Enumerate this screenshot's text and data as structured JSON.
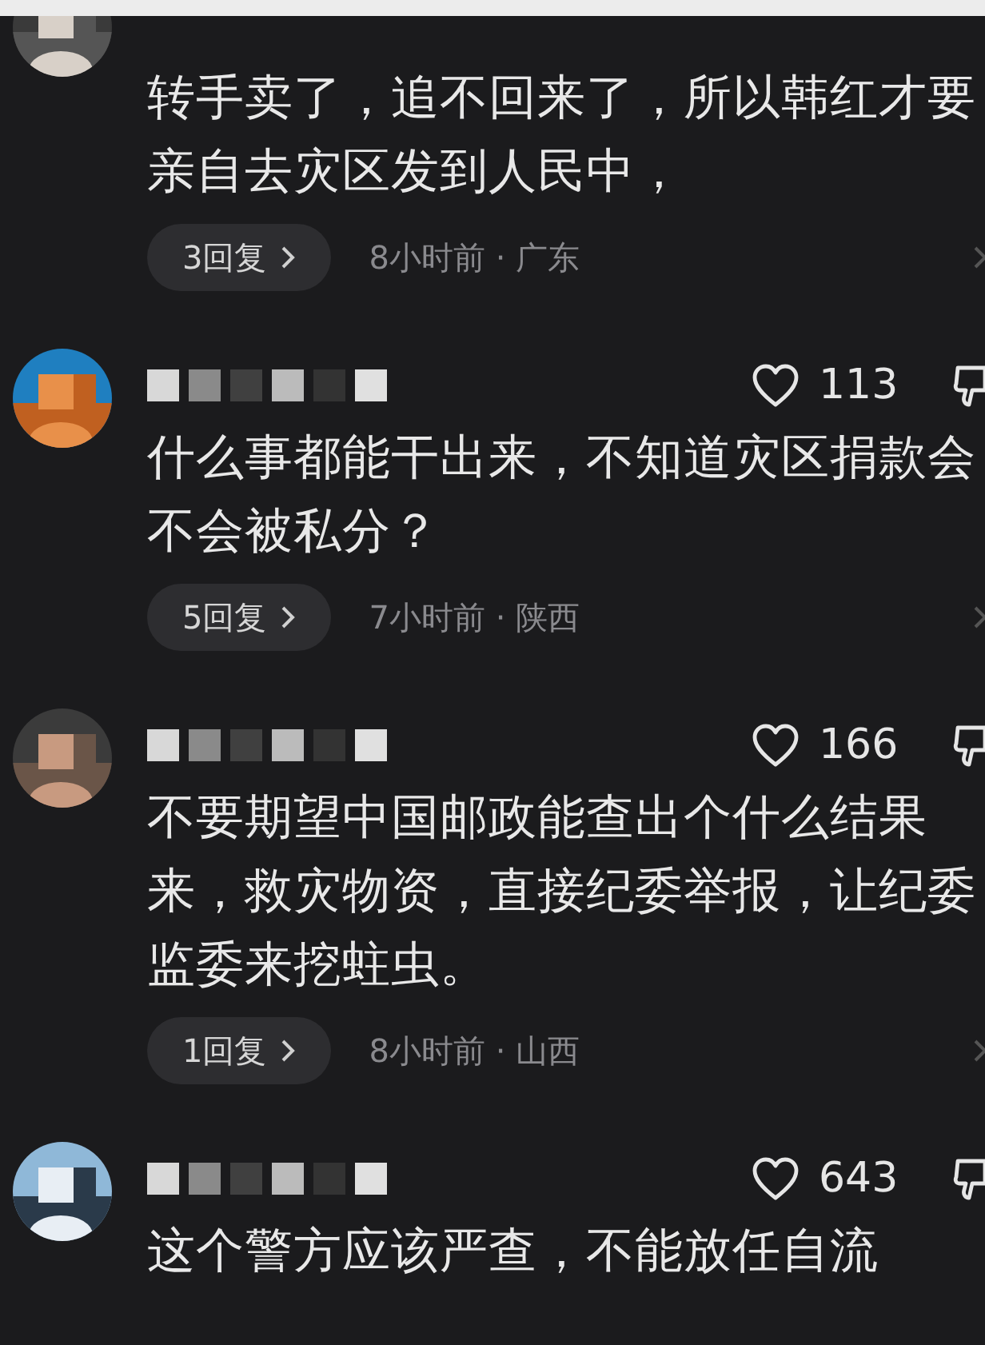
{
  "comments": [
    {
      "kind": "continued",
      "text": "转手卖了，追不回来了，所以韩红才要亲自去灾区发到人民中，",
      "replies": "3回复",
      "meta": "8小时前 · 广东"
    },
    {
      "kind": "full",
      "likes": "113",
      "text": "什么事都能干出来，不知道灾区捐款会不会被私分？",
      "replies": "5回复",
      "meta": "7小时前 · 陕西"
    },
    {
      "kind": "full",
      "likes": "166",
      "text": "不要期望中国邮政能查出个什么结果来，救灾物资，直接纪委举报，让纪委监委来挖蛀虫。",
      "replies": "1回复",
      "meta": "8小时前 · 山西"
    },
    {
      "kind": "full",
      "likes": "643",
      "text": "这个警方应该严查，不能放任自流"
    }
  ]
}
